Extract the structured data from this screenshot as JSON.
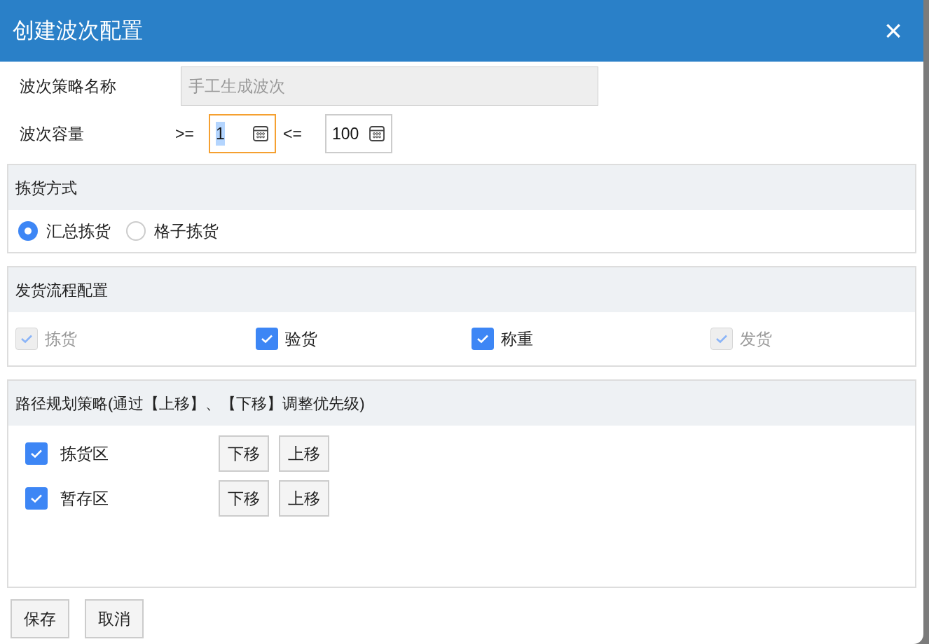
{
  "dialog": {
    "title": "创建波次配置",
    "close": "×"
  },
  "name_field": {
    "label": "波次策略名称",
    "value": "手工生成波次",
    "disabled": true
  },
  "capacity": {
    "label": "波次容量",
    "min_op": ">=",
    "max_op": "<=",
    "fields": [
      {
        "value": "1",
        "focused": true
      },
      {
        "value": "100",
        "focused": false
      }
    ]
  },
  "pick_method": {
    "title": "拣货方式",
    "options": [
      {
        "label": "汇总拣货",
        "selected": true
      },
      {
        "label": "格子拣货",
        "selected": false
      }
    ]
  },
  "flow": {
    "title": "发货流程配置",
    "items": [
      {
        "label": "拣货",
        "checked": true,
        "disabled": true
      },
      {
        "label": "验货",
        "checked": true,
        "disabled": false
      },
      {
        "label": "称重",
        "checked": true,
        "disabled": false
      },
      {
        "label": "发货",
        "checked": true,
        "disabled": true
      }
    ]
  },
  "route": {
    "title": "路径规划策略(通过【上移】、【下移】调整优先级)",
    "items": [
      {
        "label": "拣货区",
        "checked": true,
        "down": "下移",
        "up": "上移"
      },
      {
        "label": "暂存区",
        "checked": true,
        "down": "下移",
        "up": "上移"
      }
    ]
  },
  "buttons": [
    "保存",
    "取消"
  ]
}
